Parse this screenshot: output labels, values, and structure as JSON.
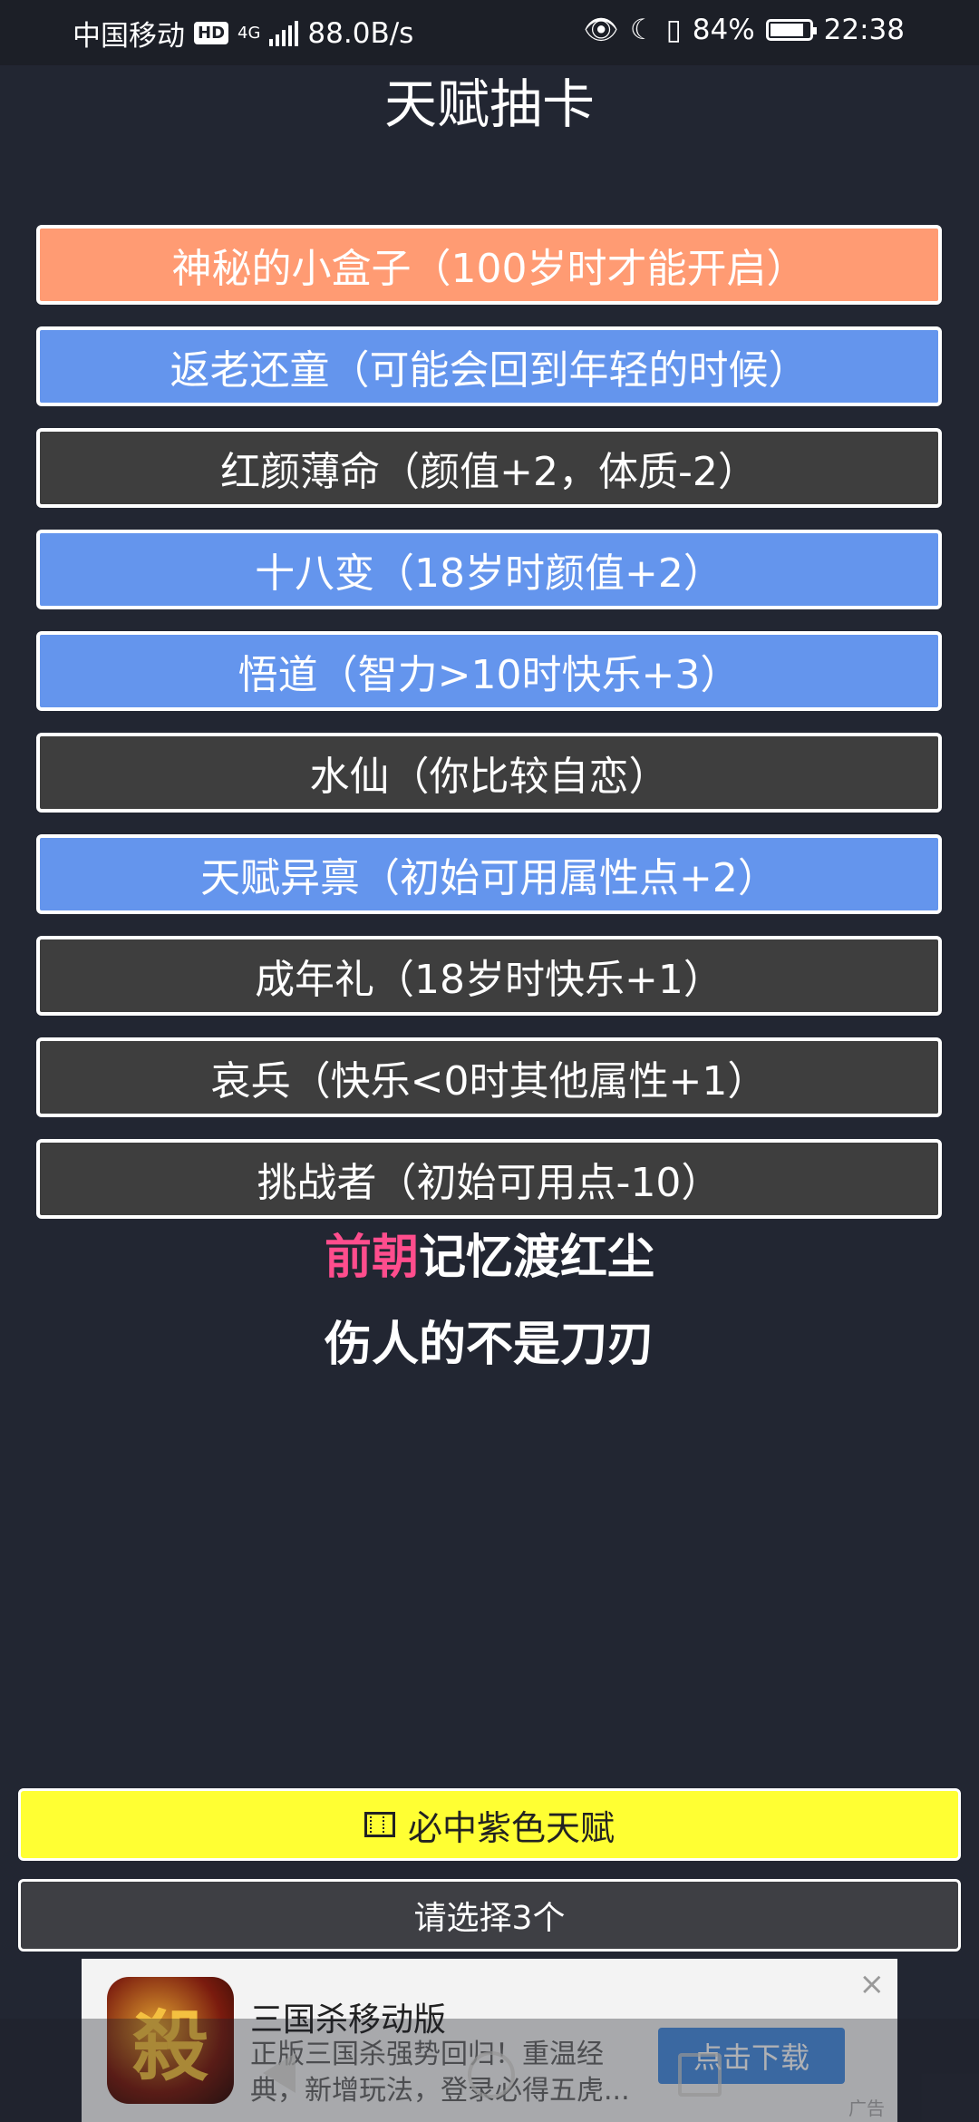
{
  "status_bar": {
    "carrier": "中国移动",
    "hd": "HD",
    "network": "4G",
    "speed": "88.0B/s",
    "battery": "84%",
    "time": "22:38"
  },
  "page": {
    "title": "天赋抽卡"
  },
  "talents": [
    {
      "label": "神秘的小盒子（100岁时才能开启）",
      "color": "#ff9b73"
    },
    {
      "label": "返老还童（可能会回到年轻的时候）",
      "color": "#6495ed"
    },
    {
      "label": "红颜薄命（颜值+2，体质-2）",
      "color": "#3e3e3e"
    },
    {
      "label": "十八变（18岁时颜值+2）",
      "color": "#6495ed"
    },
    {
      "label": "悟道（智力>10时快乐+3）",
      "color": "#6495ed"
    },
    {
      "label": "水仙（你比较自恋）",
      "color": "#3e3e3e"
    },
    {
      "label": "天赋异禀（初始可用属性点+2）",
      "color": "#6495ed"
    },
    {
      "label": "成年礼（18岁时快乐+1）",
      "color": "#3e3e3e"
    },
    {
      "label": "哀兵（快乐<0时其他属性+1）",
      "color": "#3e3e3e"
    },
    {
      "label": "挑战者（初始可用点-10）",
      "color": "#3e3e3e"
    }
  ],
  "lyrics": {
    "line1_highlight": "前朝",
    "line1_rest": "记忆渡红尘",
    "line2": "伤人的不是刀刃"
  },
  "buttons": {
    "purple_talent": "必中紫色天赋",
    "select": "请选择3个"
  },
  "ad": {
    "logo_text": "殺",
    "title": "三国杀移动版",
    "description": "正版三国杀强势回归！重温经典，新增玩法，登录必得五虎...",
    "cta": "点击下载",
    "tag": "广告",
    "close": "×"
  }
}
